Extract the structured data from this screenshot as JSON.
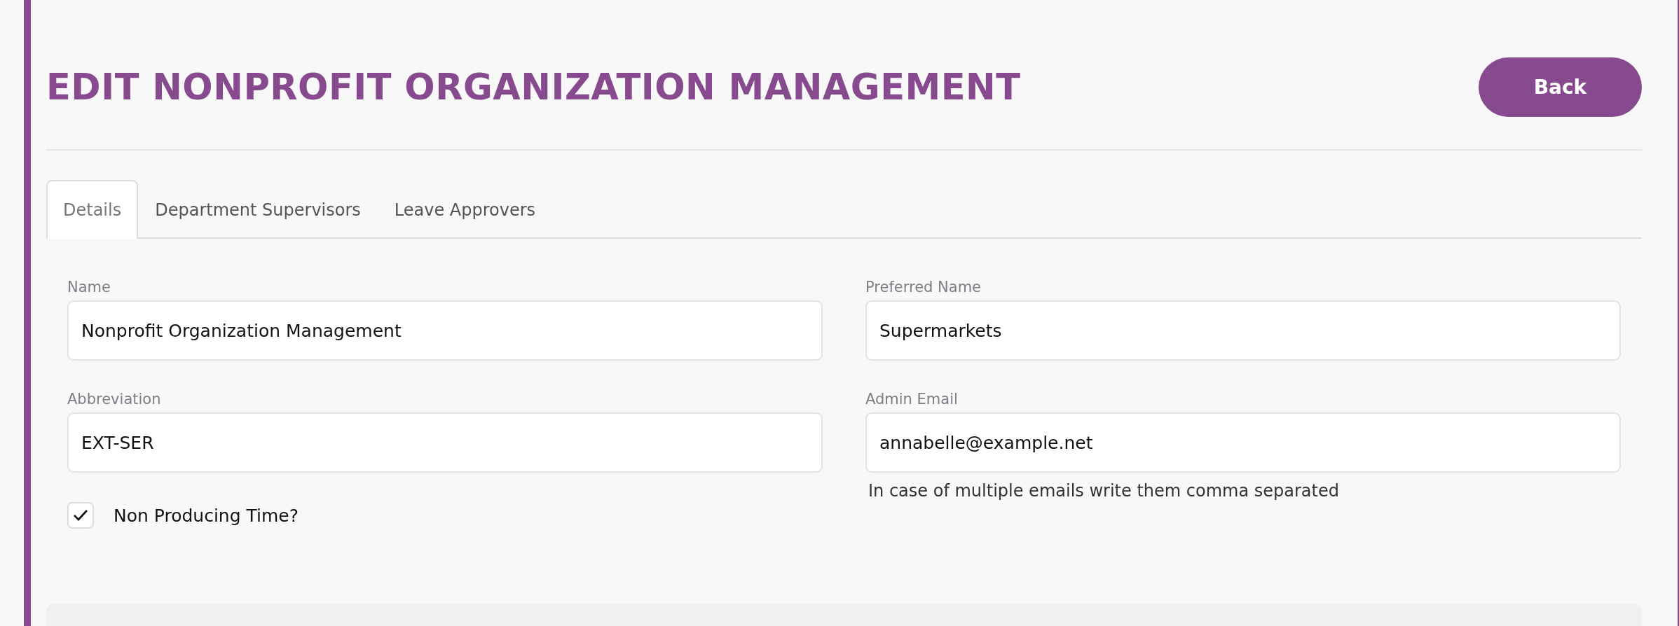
{
  "title": "EDIT NONPROFIT ORGANIZATION MANAGEMENT",
  "back_button": "Back",
  "tabs": [
    {
      "label": "Details",
      "selected": true
    },
    {
      "label": "Department Supervisors",
      "selected": false
    },
    {
      "label": "Leave Approvers",
      "selected": false
    }
  ],
  "fields": [
    {
      "label": "Name",
      "value": "Nonprofit Organization Management"
    },
    {
      "label": "Preferred Name",
      "value": "Supermarkets"
    },
    {
      "label": "Abbreviation",
      "value": "EXT-SER"
    },
    {
      "label": "Admin Email",
      "value": "annabelle@example.net",
      "help": "In case of multiple emails write them comma separated"
    }
  ],
  "non_producing_time": {
    "label": "Non Producing Time?",
    "checked": true
  }
}
